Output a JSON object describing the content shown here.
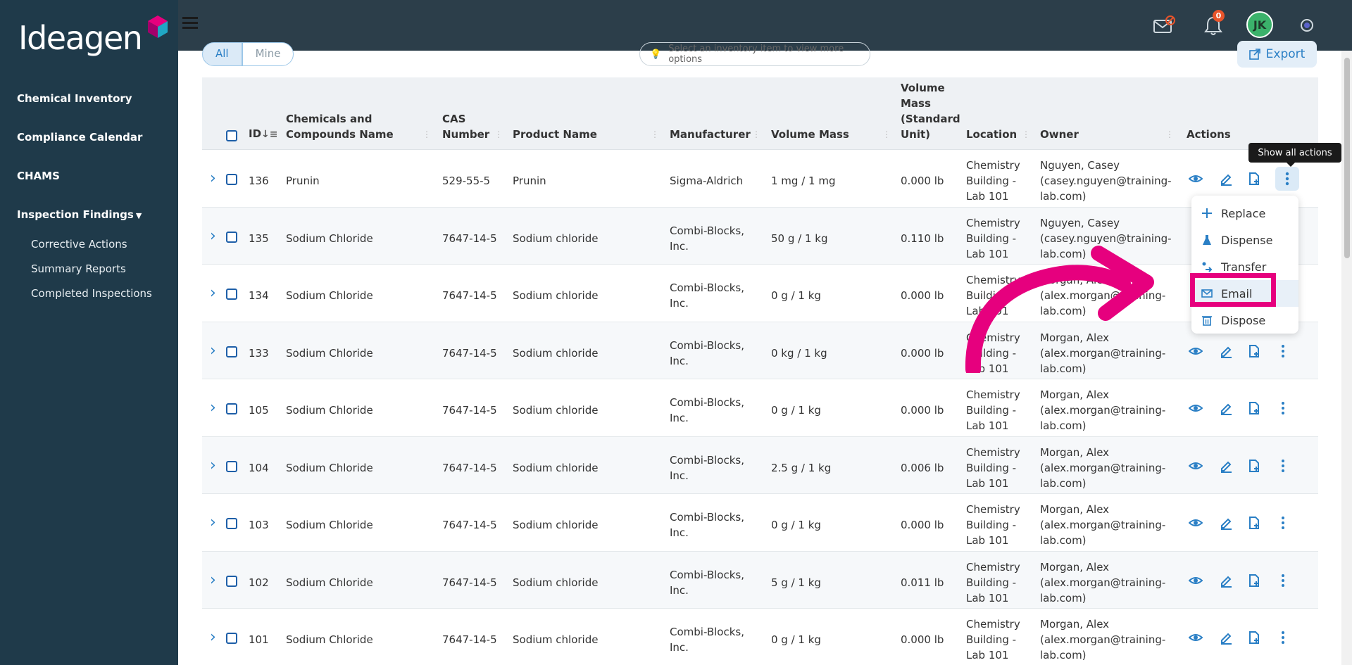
{
  "app": {
    "logo_text": "Ideagen"
  },
  "sidebar": {
    "items": [
      {
        "label": "Chemical Inventory"
      },
      {
        "label": "Compliance Calendar"
      },
      {
        "label": "CHAMS"
      },
      {
        "label": "Inspection Findings"
      }
    ],
    "sub_items": [
      {
        "label": "Corrective Actions"
      },
      {
        "label": "Summary Reports"
      },
      {
        "label": "Completed Inspections"
      }
    ]
  },
  "header": {
    "notification_count": "0",
    "avatar_initials": "JK"
  },
  "toolbar": {
    "filter_all": "All",
    "filter_mine": "Mine",
    "hint": "Select an inventory item to view more options",
    "export_label": "Export"
  },
  "table": {
    "headers": {
      "id": "ID",
      "name": "Chemicals and Compounds Name",
      "cas": "CAS Number",
      "product": "Product Name",
      "manufacturer": "Manufacturer",
      "volume": "Volume Mass",
      "volume_std": "Volume Mass (Standard Unit)",
      "location": "Location",
      "owner": "Owner",
      "actions": "Actions"
    },
    "rows": [
      {
        "id": "136",
        "name": "Prunin",
        "cas": "529-55-5",
        "product": "Prunin",
        "manufacturer": "Sigma-Aldrich",
        "volume": "1 mg / 1 mg",
        "std": "0.000 lb",
        "location": "Chemistry Building - Lab 101",
        "owner": "Nguyen, Casey (casey.nguyen@training-lab.com)"
      },
      {
        "id": "135",
        "name": "Sodium Chloride",
        "cas": "7647-14-5",
        "product": "Sodium chloride",
        "manufacturer": "Combi-Blocks, Inc.",
        "volume": "50 g / 1 kg",
        "std": "0.110 lb",
        "location": "Chemistry Building - Lab 101",
        "owner": "Nguyen, Casey (casey.nguyen@training-lab.com)"
      },
      {
        "id": "134",
        "name": "Sodium Chloride",
        "cas": "7647-14-5",
        "product": "Sodium chloride",
        "manufacturer": "Combi-Blocks, Inc.",
        "volume": "0 g / 1 kg",
        "std": "0.000 lb",
        "location": "Chemistry Building - Lab 101",
        "owner": "Morgan, Alex (alex.morgan@training-lab.com)"
      },
      {
        "id": "133",
        "name": "Sodium Chloride",
        "cas": "7647-14-5",
        "product": "Sodium chloride",
        "manufacturer": "Combi-Blocks, Inc.",
        "volume": "0 kg / 1 kg",
        "std": "0.000 lb",
        "location": "Chemistry Building - Lab 101",
        "owner": "Morgan, Alex (alex.morgan@training-lab.com)"
      },
      {
        "id": "105",
        "name": "Sodium Chloride",
        "cas": "7647-14-5",
        "product": "Sodium chloride",
        "manufacturer": "Combi-Blocks, Inc.",
        "volume": "0 g / 1 kg",
        "std": "0.000 lb",
        "location": "Chemistry Building - Lab 101",
        "owner": "Morgan, Alex (alex.morgan@training-lab.com)"
      },
      {
        "id": "104",
        "name": "Sodium Chloride",
        "cas": "7647-14-5",
        "product": "Sodium chloride",
        "manufacturer": "Combi-Blocks, Inc.",
        "volume": "2.5 g / 1 kg",
        "std": "0.006 lb",
        "location": "Chemistry Building - Lab 101",
        "owner": "Morgan, Alex (alex.morgan@training-lab.com)"
      },
      {
        "id": "103",
        "name": "Sodium Chloride",
        "cas": "7647-14-5",
        "product": "Sodium chloride",
        "manufacturer": "Combi-Blocks, Inc.",
        "volume": "0 g / 1 kg",
        "std": "0.000 lb",
        "location": "Chemistry Building - Lab 101",
        "owner": "Morgan, Alex (alex.morgan@training-lab.com)"
      },
      {
        "id": "102",
        "name": "Sodium Chloride",
        "cas": "7647-14-5",
        "product": "Sodium chloride",
        "manufacturer": "Combi-Blocks, Inc.",
        "volume": "5 g / 1 kg",
        "std": "0.011 lb",
        "location": "Chemistry Building - Lab 101",
        "owner": "Morgan, Alex (alex.morgan@training-lab.com)"
      },
      {
        "id": "101",
        "name": "Sodium Chloride",
        "cas": "7647-14-5",
        "product": "Sodium chloride",
        "manufacturer": "Combi-Blocks, Inc.",
        "volume": "0 g / 1 kg",
        "std": "0.000 lb",
        "location": "Chemistry Building - Lab 101",
        "owner": "Morgan, Alex (alex.morgan@training-lab.com)"
      }
    ]
  },
  "tooltip": "Show all actions",
  "actions_menu": [
    {
      "label": "Replace",
      "icon": "plus-icon"
    },
    {
      "label": "Dispense",
      "icon": "flask-icon"
    },
    {
      "label": "Transfer",
      "icon": "transfer-icon"
    },
    {
      "label": "Email",
      "icon": "mail-icon"
    },
    {
      "label": "Dispose",
      "icon": "trash-icon"
    }
  ],
  "colors": {
    "sidebar": "#1f3a4a",
    "accent": "#2a7fc5",
    "highlight": "#e6007e",
    "avatar": "#3bb26b"
  }
}
